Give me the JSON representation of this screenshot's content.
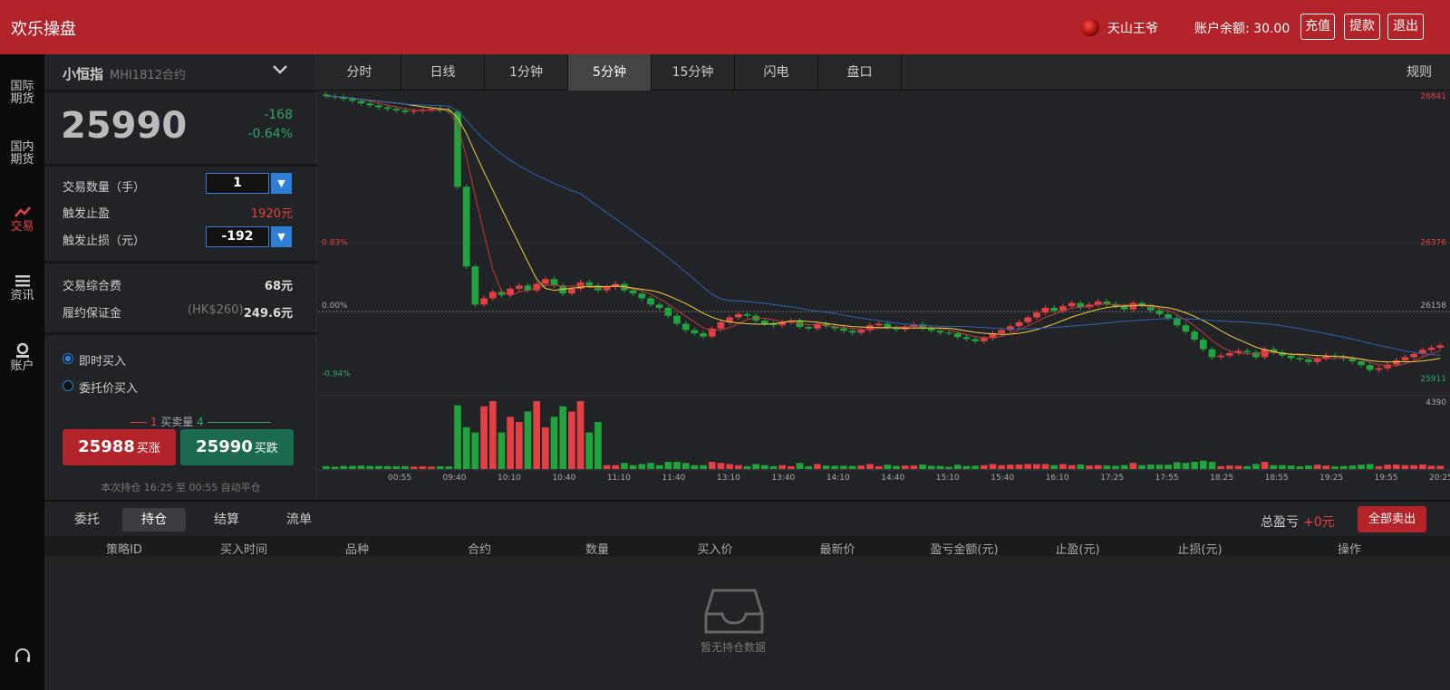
{
  "app": {
    "title": "欢乐操盘",
    "username": "天山王爷",
    "balance_label": "账户余额: 30.00",
    "buttons": {
      "recharge": "充值",
      "withdraw": "提款",
      "logout": "退出"
    }
  },
  "sidebar": {
    "items": [
      {
        "label": "国际\n期货",
        "icon": "globe"
      },
      {
        "label": "国内\n期货",
        "icon": "flag"
      },
      {
        "label": "交易",
        "icon": "trend-icon",
        "active": true
      },
      {
        "label": "资讯",
        "icon": "list-icon"
      },
      {
        "label": "账户",
        "icon": "user-icon"
      }
    ],
    "service_icon": "headset-icon"
  },
  "instrument": {
    "name": "小恒指",
    "contract": "MHI1812合约",
    "price": "25990",
    "change": "-168",
    "change_pct": "-0.64%"
  },
  "order": {
    "qty_label": "交易数量（手）",
    "qty_value": "1",
    "tp_label": "触发止盈",
    "tp_value": "1920元",
    "sl_label": "触发止损（元）",
    "sl_value": "-192"
  },
  "fees": {
    "fee_label": "交易综合费",
    "fee_value": "68元",
    "margin_label": "履约保证金",
    "margin_sub": "(HK$260)",
    "margin_value": "249.6元"
  },
  "buy_mode": {
    "opt1": "即时买入",
    "opt2": "委托价买入"
  },
  "buy_sell": {
    "legend_left": "1",
    "legend_mid": "买卖量",
    "legend_right": "4",
    "up_price": "25988",
    "up_label": "买涨",
    "down_price": "25990",
    "down_label": "买跌",
    "hold_note": "本次持仓 16:25 至 00:55 自动平仓"
  },
  "chart_tabs": [
    "分时",
    "日线",
    "1分钟",
    "5分钟",
    "15分钟",
    "闪电",
    "盘口"
  ],
  "chart_active_tab": "5分钟",
  "chart_rule": "规则",
  "chart_labels": {
    "left_top": "0.83%",
    "left_mid": "0.00%",
    "left_bot": "-0.94%",
    "right_1": "26841",
    "right_2": "26376",
    "right_3": "26158",
    "right_4": "25911",
    "vol_max": "4390"
  },
  "bottom": {
    "tabs": [
      "委托",
      "持仓",
      "结算",
      "流单"
    ],
    "active_tab": "持仓",
    "pl_label": "总盈亏",
    "pl_value": "+0元",
    "sell_all": "全部卖出",
    "columns": [
      "策略ID",
      "买入时间",
      "品种",
      "合约",
      "数量",
      "买入价",
      "最新价",
      "盈亏金额(元)",
      "止盈(元)",
      "止损(元)",
      "操作"
    ],
    "empty_text": "暂无持仓数据"
  },
  "chart_data": {
    "type": "candlestick",
    "x_ticks": [
      "00:55",
      "09:40",
      "10:10",
      "10:40",
      "11:10",
      "11:40",
      "13:10",
      "13:40",
      "14:10",
      "14:40",
      "15:10",
      "15:40",
      "16:10",
      "17:25",
      "17:55",
      "18:25",
      "18:55",
      "19:25",
      "19:55",
      "20:25"
    ],
    "y_range": [
      25911,
      26841
    ],
    "close": [
      26835,
      26832,
      26826,
      26820,
      26812,
      26806,
      26800,
      26795,
      26790,
      26785,
      26788,
      26792,
      26795,
      26790,
      26786,
      26550,
      26300,
      26180,
      26200,
      26220,
      26210,
      26230,
      26240,
      26225,
      26245,
      26260,
      26240,
      26215,
      26230,
      26250,
      26240,
      26225,
      26235,
      26245,
      26225,
      26215,
      26200,
      26180,
      26170,
      26145,
      26120,
      26100,
      26090,
      26080,
      26105,
      26125,
      26140,
      26150,
      26145,
      26130,
      26120,
      26115,
      26125,
      26130,
      26110,
      26105,
      26120,
      26112,
      26105,
      26098,
      26092,
      26100,
      26115,
      26120,
      26108,
      26102,
      26110,
      26118,
      26105,
      26098,
      26092,
      26090,
      26078,
      26072,
      26065,
      26075,
      26090,
      26100,
      26112,
      26125,
      26140,
      26155,
      26170,
      26160,
      26175,
      26185,
      26172,
      26180,
      26190,
      26182,
      26175,
      26165,
      26185,
      26175,
      26162,
      26150,
      26138,
      26115,
      26095,
      26070,
      26040,
      26015,
      26020,
      26028,
      26035,
      26030,
      26015,
      26040,
      26030,
      26020,
      26012,
      26008,
      26000,
      26012,
      26020,
      26016,
      26010,
      26002,
      25990,
      25975,
      25980,
      25992,
      26005,
      26015,
      26025,
      26038,
      26045,
      26052
    ]
  }
}
